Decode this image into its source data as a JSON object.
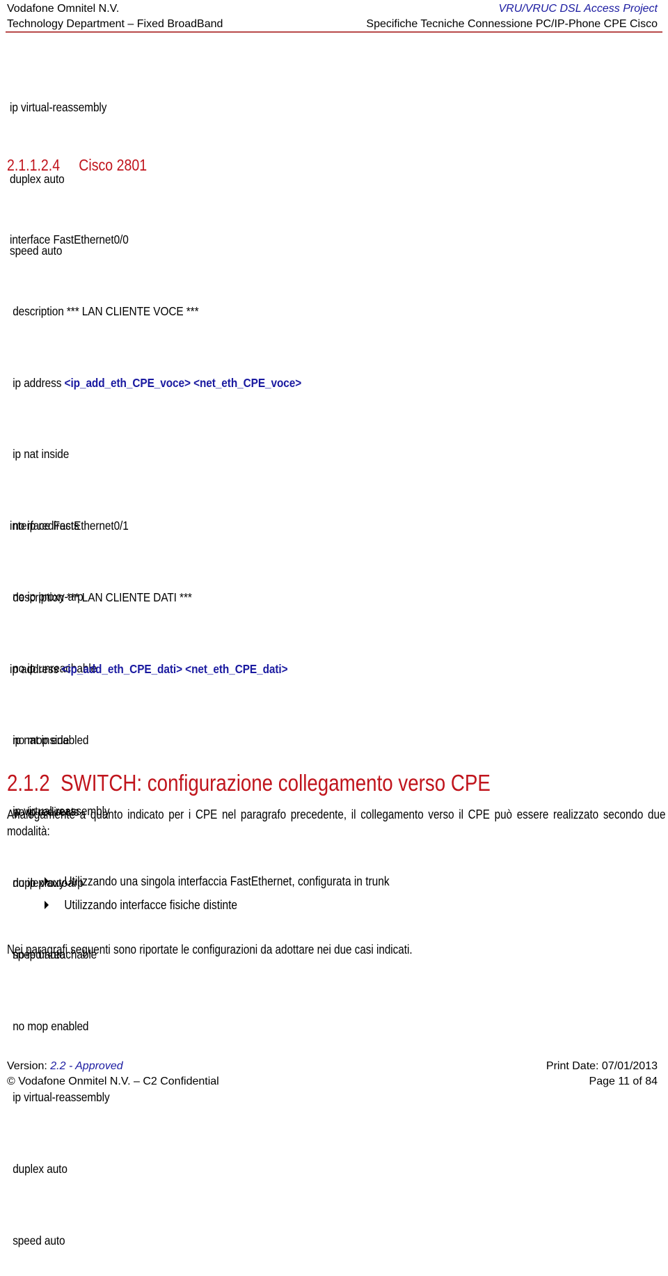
{
  "header": {
    "company": "Vodafone Omnitel N.V.",
    "department": "Technology Department – Fixed BroadBand",
    "project": "VRU/VRUC DSL Access Project",
    "document_title": "Specifiche Tecniche Connessione PC/IP-Phone CPE Cisco"
  },
  "intro_lines": [
    "ip virtual-reassembly",
    "duplex auto",
    "speed auto"
  ],
  "section_cisco2801": {
    "number": "2.1.1.2.4",
    "title": "Cisco 2801",
    "interface_voce": {
      "interface": "interface FastEthernet0/0",
      "description": " description *** LAN CLIENTE VOCE ***",
      "ip_address_prefix": " ip address ",
      "ip_placeholder": "<ip_add_eth_CPE_voce>",
      "net_placeholder": "<net_eth_CPE_voce>",
      "lines": [
        " ip nat inside",
        " no ip redirects",
        " no ip proxy-arp",
        " no ip unreachable",
        " no mop enabled",
        " ip virtual-reassembly",
        " duplex auto",
        " speed auto"
      ]
    },
    "interface_dati": {
      "interface": "interface FastEthernet0/1",
      "description": " description *** LAN CLIENTE DATI ***",
      "ip_address_prefix": "ip address ",
      "ip_placeholder": "<ip_add_eth_CPE_dati>",
      "net_placeholder": "<net_eth_CPE_dati>",
      "lines": [
        " ip nat inside",
        " no ip redirects",
        " no ip proxy-arp",
        " no ip unreachable",
        " no mop enabled",
        " ip virtual-reassembly",
        " duplex auto",
        " speed auto"
      ]
    }
  },
  "section_switch": {
    "number": "2.1.2",
    "title": "SWITCH: configurazione collegamento verso CPE",
    "paragraph": "Analogamente a quanto indicato per i CPE nel paragrafo precedente, il collegamento verso il CPE può essere realizzato secondo due modalità:",
    "bullets": [
      "Utilizzando una singola interfaccia FastEthernet, configurata in trunk",
      "Utilizzando interfacce fisiche distinte"
    ],
    "closing": "Nei paragrafi seguenti sono riportate le configurazioni da adottare nei due casi indicati."
  },
  "footer": {
    "version_label": "Version: ",
    "version_value": "2.2 - Approved",
    "copyright": "© Vodafone Onmitel N.V. – C2 Confidential",
    "print_date": "Print Date: 07/01/2013",
    "page": "Page 11 of 84"
  },
  "colors": {
    "heading_red": "#c0141c",
    "placeholder_blue": "#1a1aa0",
    "header_rule": "#b84a4a"
  }
}
